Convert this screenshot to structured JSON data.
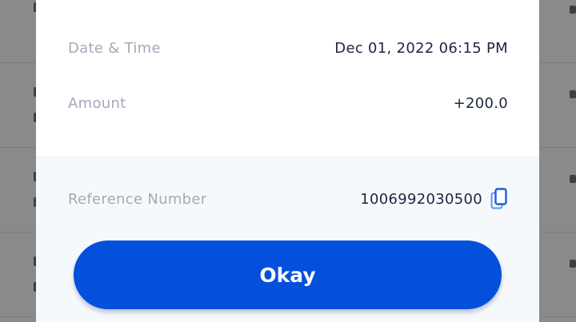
{
  "details": {
    "date_time_label": "Date & Time",
    "date_time_value": "Dec 01, 2022 06:15 PM",
    "amount_label": "Amount",
    "amount_value": "+200.0",
    "reference_label": "Reference Number",
    "reference_value": "1006992030500"
  },
  "actions": {
    "okay_label": "Okay"
  },
  "icons": {
    "copy": "copy-icon"
  },
  "colors": {
    "primary_button": "#0450dc",
    "label_text": "#a3aab8",
    "value_text": "#1c2640",
    "overlay": "#8a8a8a",
    "sheet_bottom": "#f6f9fc"
  }
}
